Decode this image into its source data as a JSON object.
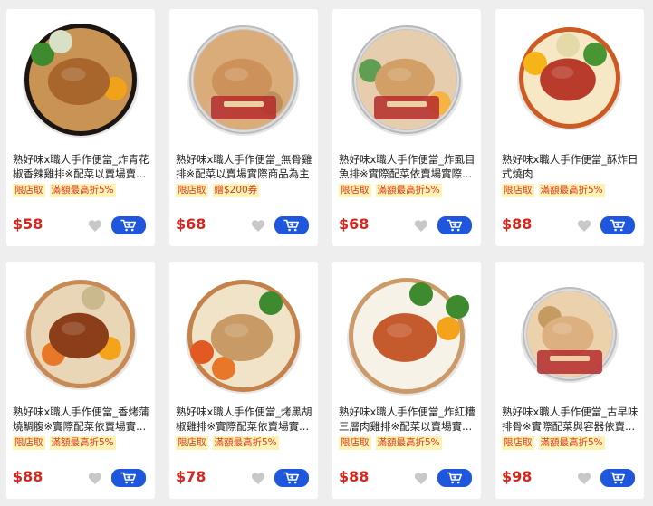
{
  "products": [
    {
      "title": "熟好味x職人手作便當_炸青花椒香辣雞排※配菜以賣場賣...",
      "tags": [
        "限店取",
        "滿額最高折5%"
      ],
      "price": "$58",
      "image": "bento-fried-chicken-bowl"
    },
    {
      "title": "熟好味x職人手作便當_無骨雞排※配菜以賣場實際商品為主",
      "tags": [
        "限店取",
        "贈$200券"
      ],
      "price": "$68",
      "image": "bento-boneless-chicken-lidded"
    },
    {
      "title": "熟好味x職人手作便當_炸虱目魚排※實際配菜依賣場實際...",
      "tags": [
        "限店取",
        "滿額最高折5%"
      ],
      "price": "$68",
      "image": "bento-milkfish-lidded"
    },
    {
      "title": "熟好味x職人手作便當_酥炸日式燒肉",
      "tags": [
        "限店取",
        "滿額最高折5%"
      ],
      "price": "$88",
      "image": "bento-japanese-bbq-pork"
    },
    {
      "title": "熟好味x職人手作便當_香烤蒲燒鯛腹※實際配菜依賣場實...",
      "tags": [
        "限店取",
        "滿額最高折5%"
      ],
      "price": "$88",
      "image": "bento-kabayaki-fish"
    },
    {
      "title": "熟好味x職人手作便當_烤黑胡椒雞排※實際配菜依賣場實...",
      "tags": [
        "限店取",
        "滿額最高折5%"
      ],
      "price": "$78",
      "image": "bento-black-pepper-chicken"
    },
    {
      "title": "熟好味x職人手作便當_炸紅糟三層肉雞排※配菜以賣場實...",
      "tags": [
        "限店取",
        "滿額最高折5%"
      ],
      "price": "$88",
      "image": "bento-red-yeast-pork-chicken"
    },
    {
      "title": "熟好味x職人手作便當_古早味排骨※實際配菜與容器依賣...",
      "tags": [
        "限店取",
        "滿額最高折5%"
      ],
      "price": "$98",
      "image": "bento-pork-chop-lidded"
    }
  ],
  "colors": {
    "price": "#d7241c",
    "tag_bg": "#fdf3b5",
    "tag_text": "#d83a1e",
    "cart_button": "#1e57de",
    "heart": "#c8c8c8"
  },
  "icons": {
    "favorite": "heart-icon",
    "cart": "cart-icon"
  }
}
